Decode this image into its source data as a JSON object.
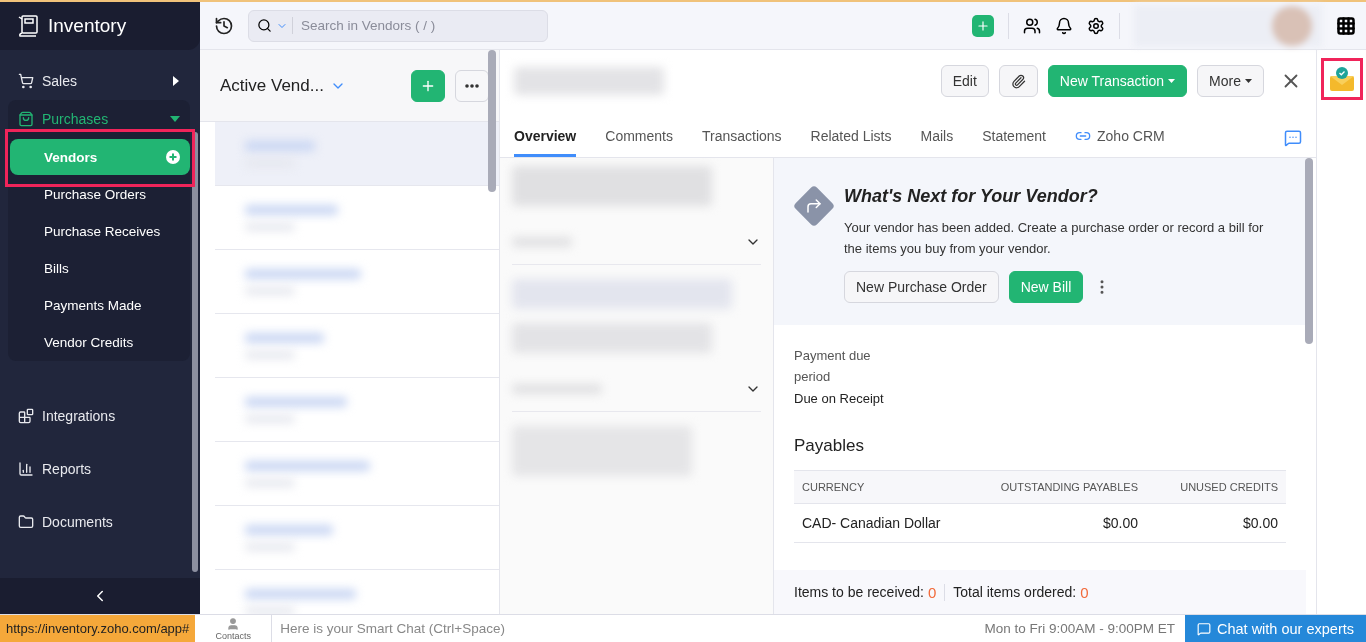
{
  "app": {
    "name": "Inventory"
  },
  "sidebar": {
    "items": [
      {
        "label": "Sales",
        "kind": "group",
        "expanded": false
      },
      {
        "label": "Purchases",
        "kind": "group",
        "expanded": true,
        "children": [
          {
            "label": "Vendors",
            "selected": true
          },
          {
            "label": "Purchase Orders",
            "selected": false
          },
          {
            "label": "Purchase Receives",
            "selected": false
          },
          {
            "label": "Bills",
            "selected": false
          },
          {
            "label": "Payments Made",
            "selected": false
          },
          {
            "label": "Vendor Credits",
            "selected": false
          }
        ]
      },
      {
        "label": "Integrations",
        "kind": "link"
      },
      {
        "label": "Reports",
        "kind": "link"
      },
      {
        "label": "Documents",
        "kind": "link"
      }
    ]
  },
  "search": {
    "placeholder": "Search in Vendors ( / )"
  },
  "list": {
    "title": "Active Vend..."
  },
  "detail": {
    "buttons": [
      {
        "label": "Edit",
        "kind": "plain"
      },
      {
        "kind": "attach"
      },
      {
        "label": "New Transaction",
        "kind": "primary"
      },
      {
        "label": "More",
        "kind": "menu"
      }
    ],
    "tabs": [
      {
        "label": "Overview",
        "selected": true
      },
      {
        "label": "Comments",
        "selected": false
      },
      {
        "label": "Transactions",
        "selected": false
      },
      {
        "label": "Related Lists",
        "selected": false
      },
      {
        "label": "Mails",
        "selected": false
      },
      {
        "label": "Statement",
        "selected": false
      },
      {
        "label": "Zoho CRM",
        "selected": false,
        "kind": "crm"
      }
    ],
    "next": {
      "title": "What's Next for Your Vendor?",
      "text": "Your vendor has been added. Create a purchase order or record a bill for the items you buy from your vendor.",
      "buttons": [
        {
          "label": "New Purchase Order",
          "kind": "plain"
        },
        {
          "label": "New Bill",
          "kind": "primary"
        }
      ]
    },
    "payment": {
      "label": "Payment due period",
      "value": "Due on Receipt"
    },
    "payables": {
      "title": "Payables",
      "columns": [
        "CURRENCY",
        "OUTSTANDING PAYABLES",
        "UNUSED CREDITS"
      ],
      "rows": [
        [
          "CAD- Canadian Dollar",
          "$0.00",
          "$0.00"
        ]
      ]
    },
    "footer": [
      {
        "label": "Items to be received:",
        "value": "0"
      },
      {
        "label": "Total items ordered:",
        "value": "0"
      }
    ]
  },
  "bottom_bar": {
    "url": "https://inventory.zoho.com/app#",
    "contacts": "Contacts",
    "chat_placeholder": "Here is your Smart Chat (Ctrl+Space)",
    "hours": "Mon to Fri 9:00AM - 9:00PM ET",
    "chat_button": "Chat with our experts"
  }
}
